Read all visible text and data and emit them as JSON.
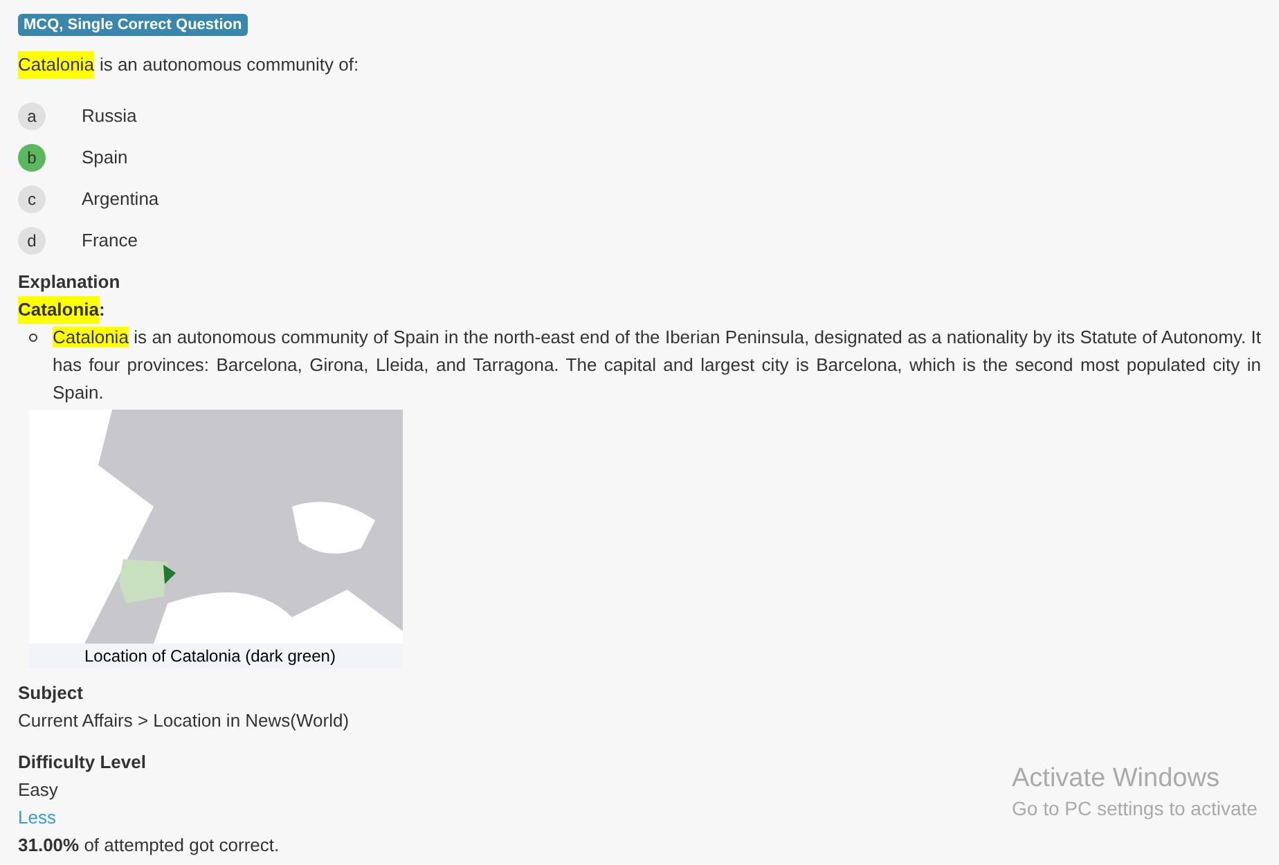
{
  "badge": "MCQ, Single Correct Question",
  "question": {
    "highlight": "Catalonia",
    "text": "is an autonomous community of:"
  },
  "options": [
    {
      "letter": "a",
      "label": "Russia",
      "selected": false
    },
    {
      "letter": "b",
      "label": "Spain",
      "selected": true
    },
    {
      "letter": "c",
      "label": "Argentina",
      "selected": false
    },
    {
      "letter": "d",
      "label": "France",
      "selected": false
    }
  ],
  "explanation": {
    "heading": "Explanation",
    "term": "Catalonia",
    "term_suffix": ":",
    "bullets": [
      {
        "highlight": "Catalonia",
        "text": "is an autonomous community of Spain in the north-east end of the Iberian Peninsula, designated as a nationality by its Statute of Autonomy. It has four provinces: Barcelona, Girona, Lleida, and Tarragona. The capital and largest city is Barcelona, which is the second most populated city in Spain."
      }
    ],
    "figure_caption": "Location of Catalonia (dark green)"
  },
  "subject": {
    "heading": "Subject",
    "value": "Current Affairs > Location in News(World)"
  },
  "difficulty": {
    "heading": "Difficulty Level",
    "value": "Easy",
    "toggle_link": "Less",
    "stat_bold": "31.00%",
    "stat_text": "of attempted got correct."
  },
  "os_overlay": {
    "title": "Activate Windows",
    "text": "Go to PC settings to activate"
  }
}
